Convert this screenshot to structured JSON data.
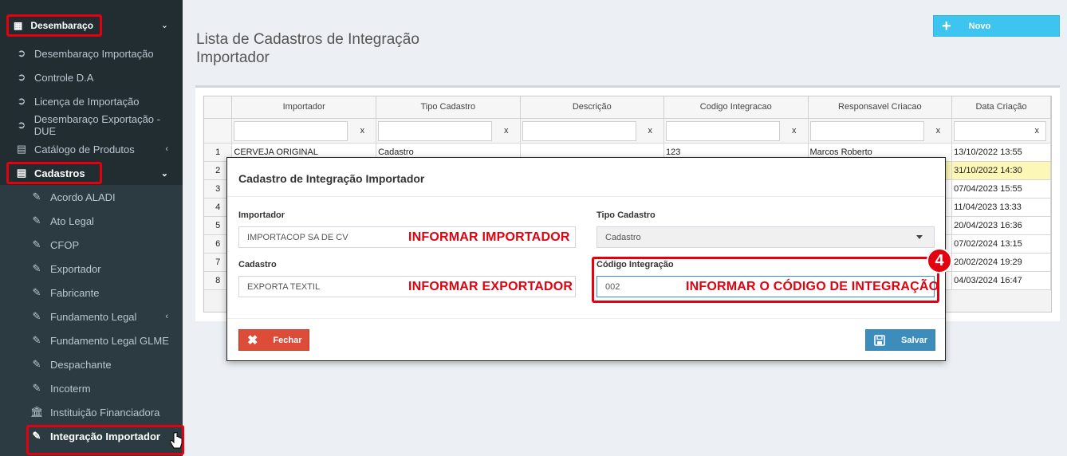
{
  "sidebar": {
    "header": "Desembaraço",
    "items": [
      {
        "label": "Desembaraço Importação",
        "icon": "arrow-circle-right-icon"
      },
      {
        "label": "Controle D.A",
        "icon": "arrow-circle-right-icon"
      },
      {
        "label": "Licença de Importação",
        "icon": "arrow-circle-right-icon"
      },
      {
        "label": "Desembaraço Exportação - DUE",
        "icon": "arrow-circle-right-icon"
      },
      {
        "label": "Catálogo de Produtos",
        "icon": "book-icon"
      },
      {
        "label": "Cadastros",
        "icon": "book-icon"
      }
    ],
    "sub_items": [
      {
        "label": "Acordo ALADI"
      },
      {
        "label": "Ato Legal"
      },
      {
        "label": "CFOP"
      },
      {
        "label": "Exportador"
      },
      {
        "label": "Fabricante"
      },
      {
        "label": "Fundamento Legal"
      },
      {
        "label": "Fundamento Legal GLME"
      },
      {
        "label": "Despachante"
      },
      {
        "label": "Incoterm"
      },
      {
        "label": "Instituição Financiadora"
      },
      {
        "label": "Integração Importador"
      }
    ]
  },
  "page": {
    "title": "Lista de Cadastros de Integração Importador",
    "new_button": "Novo"
  },
  "grid": {
    "columns": [
      "Importador",
      "Tipo Cadastro",
      "Descrição",
      "Codigo Integracao",
      "Responsavel Criacao",
      "Data Criação"
    ],
    "clear_label": "x",
    "rows": [
      {
        "n": "1",
        "importador": "CERVEJA ORIGINAL",
        "tipo": "Cadastro",
        "descricao": "",
        "codigo": "123",
        "responsavel": "Marcos Roberto",
        "data": "13/10/2022 13:55"
      },
      {
        "n": "2",
        "data": "31/10/2022 14:30"
      },
      {
        "n": "3",
        "data": "07/04/2023 15:55"
      },
      {
        "n": "4",
        "data": "11/04/2023 13:33"
      },
      {
        "n": "5",
        "data": "20/04/2023 16:36"
      },
      {
        "n": "6",
        "data": "07/02/2024 13:15"
      },
      {
        "n": "7",
        "data": "20/02/2024 19:29"
      },
      {
        "n": "8",
        "data": "04/03/2024 16:47"
      }
    ]
  },
  "modal": {
    "title": "Cadastro de Integração Importador",
    "importador_label": "Importador",
    "importador_value": "IMPORTACOP SA DE CV",
    "tipo_label": "Tipo Cadastro",
    "tipo_value": "Cadastro",
    "cadastro_label": "Cadastro",
    "cadastro_value": "EXPORTA TEXTIL",
    "codigo_label": "Código Integração",
    "codigo_value": "002",
    "close_button": "Fechar",
    "save_button": "Salvar"
  },
  "annotations": {
    "importador": "INFORMAR IMPORTADOR",
    "exportador": "INFORMAR EXPORTADOR",
    "codigo": "INFORMAR O CÓDIGO DE INTEGRAÇÃO",
    "step": "4"
  },
  "colors": {
    "sidebar_bg": "#222d32",
    "accent_red": "#e3000f",
    "novo_button": "#3dc5ef",
    "close_button": "#dd4b39",
    "save_button": "#3c8dbc",
    "highlight_row": "#fcf7b6"
  }
}
